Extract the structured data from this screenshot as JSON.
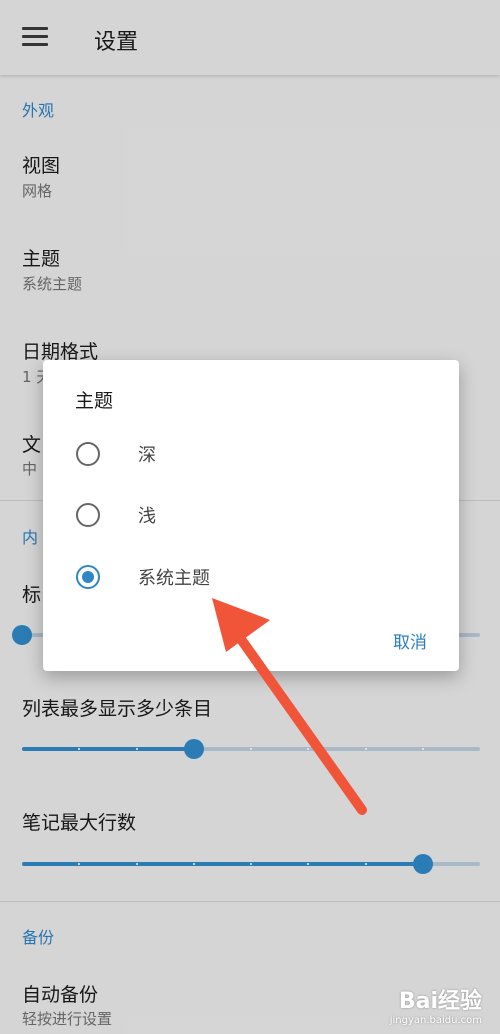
{
  "appbar": {
    "title": "设置",
    "menu_icon": "hamburger-menu-icon"
  },
  "sections": {
    "appearance": {
      "header": "外观",
      "view": {
        "title": "视图",
        "summary": "网格"
      },
      "theme": {
        "title": "主题",
        "summary": "系统主题"
      },
      "date_format": {
        "title": "日期格式",
        "summary": "1 天"
      },
      "text_size": {
        "title": "文",
        "summary": "中"
      }
    },
    "content": {
      "header": "内",
      "title_setting": {
        "title": "标"
      },
      "list_max": {
        "title": "列表最多显示多少条目"
      },
      "note_max_lines": {
        "title": "笔记最大行数"
      }
    },
    "backup": {
      "header": "备份",
      "auto_backup": {
        "title": "自动备份",
        "summary": "轻按进行设置"
      }
    }
  },
  "sliders": {
    "title_setting": {
      "value": 0,
      "steps": 9
    },
    "list_max": {
      "value": 3,
      "steps": 9
    },
    "note_max_lines": {
      "value": 7,
      "steps": 9
    }
  },
  "dialog": {
    "title": "主题",
    "options": [
      {
        "label": "深",
        "selected": false
      },
      {
        "label": "浅",
        "selected": false
      },
      {
        "label": "系统主题",
        "selected": true
      }
    ],
    "cancel_label": "取消"
  },
  "colors": {
    "accent": "#2f87c5",
    "arrow": "#f0553a",
    "background": "#e8e8e8"
  },
  "watermark": {
    "logo": "Bai经验",
    "url": "jingyan.baidu.com"
  }
}
